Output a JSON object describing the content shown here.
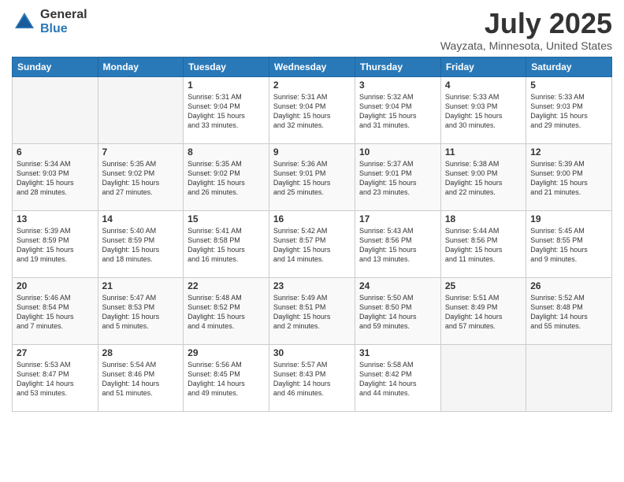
{
  "header": {
    "logo_general": "General",
    "logo_blue": "Blue",
    "month_title": "July 2025",
    "location": "Wayzata, Minnesota, United States"
  },
  "days_of_week": [
    "Sunday",
    "Monday",
    "Tuesday",
    "Wednesday",
    "Thursday",
    "Friday",
    "Saturday"
  ],
  "weeks": [
    [
      {
        "day": "",
        "info": ""
      },
      {
        "day": "",
        "info": ""
      },
      {
        "day": "1",
        "info": "Sunrise: 5:31 AM\nSunset: 9:04 PM\nDaylight: 15 hours\nand 33 minutes."
      },
      {
        "day": "2",
        "info": "Sunrise: 5:31 AM\nSunset: 9:04 PM\nDaylight: 15 hours\nand 32 minutes."
      },
      {
        "day": "3",
        "info": "Sunrise: 5:32 AM\nSunset: 9:04 PM\nDaylight: 15 hours\nand 31 minutes."
      },
      {
        "day": "4",
        "info": "Sunrise: 5:33 AM\nSunset: 9:03 PM\nDaylight: 15 hours\nand 30 minutes."
      },
      {
        "day": "5",
        "info": "Sunrise: 5:33 AM\nSunset: 9:03 PM\nDaylight: 15 hours\nand 29 minutes."
      }
    ],
    [
      {
        "day": "6",
        "info": "Sunrise: 5:34 AM\nSunset: 9:03 PM\nDaylight: 15 hours\nand 28 minutes."
      },
      {
        "day": "7",
        "info": "Sunrise: 5:35 AM\nSunset: 9:02 PM\nDaylight: 15 hours\nand 27 minutes."
      },
      {
        "day": "8",
        "info": "Sunrise: 5:35 AM\nSunset: 9:02 PM\nDaylight: 15 hours\nand 26 minutes."
      },
      {
        "day": "9",
        "info": "Sunrise: 5:36 AM\nSunset: 9:01 PM\nDaylight: 15 hours\nand 25 minutes."
      },
      {
        "day": "10",
        "info": "Sunrise: 5:37 AM\nSunset: 9:01 PM\nDaylight: 15 hours\nand 23 minutes."
      },
      {
        "day": "11",
        "info": "Sunrise: 5:38 AM\nSunset: 9:00 PM\nDaylight: 15 hours\nand 22 minutes."
      },
      {
        "day": "12",
        "info": "Sunrise: 5:39 AM\nSunset: 9:00 PM\nDaylight: 15 hours\nand 21 minutes."
      }
    ],
    [
      {
        "day": "13",
        "info": "Sunrise: 5:39 AM\nSunset: 8:59 PM\nDaylight: 15 hours\nand 19 minutes."
      },
      {
        "day": "14",
        "info": "Sunrise: 5:40 AM\nSunset: 8:59 PM\nDaylight: 15 hours\nand 18 minutes."
      },
      {
        "day": "15",
        "info": "Sunrise: 5:41 AM\nSunset: 8:58 PM\nDaylight: 15 hours\nand 16 minutes."
      },
      {
        "day": "16",
        "info": "Sunrise: 5:42 AM\nSunset: 8:57 PM\nDaylight: 15 hours\nand 14 minutes."
      },
      {
        "day": "17",
        "info": "Sunrise: 5:43 AM\nSunset: 8:56 PM\nDaylight: 15 hours\nand 13 minutes."
      },
      {
        "day": "18",
        "info": "Sunrise: 5:44 AM\nSunset: 8:56 PM\nDaylight: 15 hours\nand 11 minutes."
      },
      {
        "day": "19",
        "info": "Sunrise: 5:45 AM\nSunset: 8:55 PM\nDaylight: 15 hours\nand 9 minutes."
      }
    ],
    [
      {
        "day": "20",
        "info": "Sunrise: 5:46 AM\nSunset: 8:54 PM\nDaylight: 15 hours\nand 7 minutes."
      },
      {
        "day": "21",
        "info": "Sunrise: 5:47 AM\nSunset: 8:53 PM\nDaylight: 15 hours\nand 5 minutes."
      },
      {
        "day": "22",
        "info": "Sunrise: 5:48 AM\nSunset: 8:52 PM\nDaylight: 15 hours\nand 4 minutes."
      },
      {
        "day": "23",
        "info": "Sunrise: 5:49 AM\nSunset: 8:51 PM\nDaylight: 15 hours\nand 2 minutes."
      },
      {
        "day": "24",
        "info": "Sunrise: 5:50 AM\nSunset: 8:50 PM\nDaylight: 14 hours\nand 59 minutes."
      },
      {
        "day": "25",
        "info": "Sunrise: 5:51 AM\nSunset: 8:49 PM\nDaylight: 14 hours\nand 57 minutes."
      },
      {
        "day": "26",
        "info": "Sunrise: 5:52 AM\nSunset: 8:48 PM\nDaylight: 14 hours\nand 55 minutes."
      }
    ],
    [
      {
        "day": "27",
        "info": "Sunrise: 5:53 AM\nSunset: 8:47 PM\nDaylight: 14 hours\nand 53 minutes."
      },
      {
        "day": "28",
        "info": "Sunrise: 5:54 AM\nSunset: 8:46 PM\nDaylight: 14 hours\nand 51 minutes."
      },
      {
        "day": "29",
        "info": "Sunrise: 5:56 AM\nSunset: 8:45 PM\nDaylight: 14 hours\nand 49 minutes."
      },
      {
        "day": "30",
        "info": "Sunrise: 5:57 AM\nSunset: 8:43 PM\nDaylight: 14 hours\nand 46 minutes."
      },
      {
        "day": "31",
        "info": "Sunrise: 5:58 AM\nSunset: 8:42 PM\nDaylight: 14 hours\nand 44 minutes."
      },
      {
        "day": "",
        "info": ""
      },
      {
        "day": "",
        "info": ""
      }
    ]
  ]
}
